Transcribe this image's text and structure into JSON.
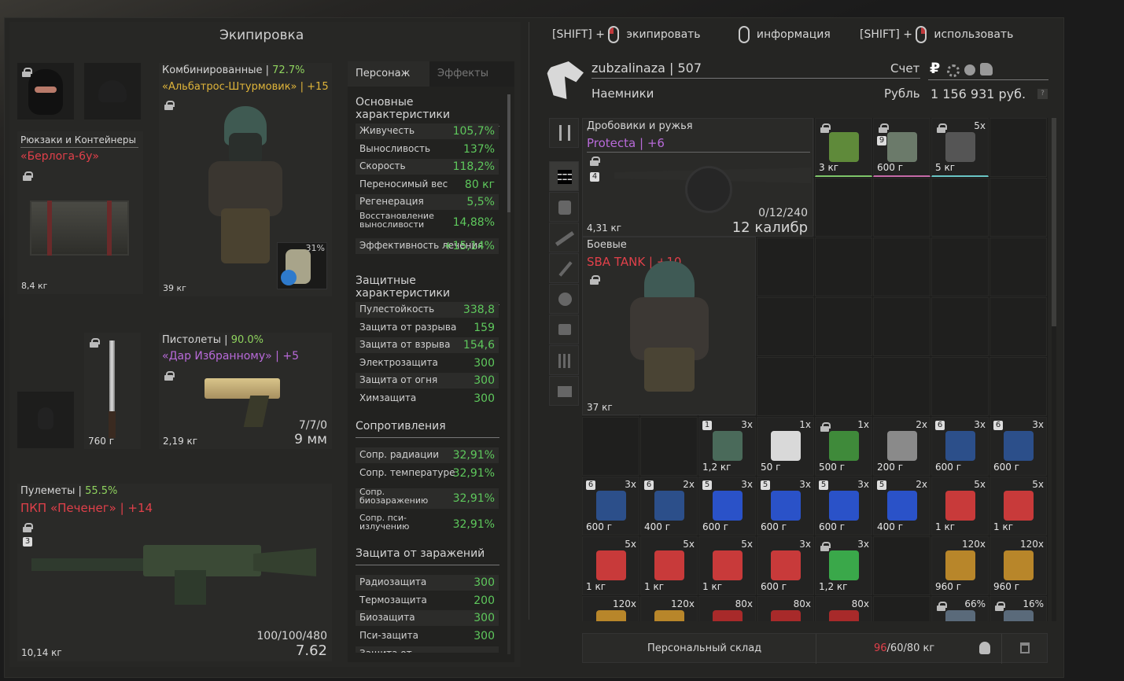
{
  "window_title": "Экипировка",
  "hints": [
    {
      "prefix": "[SHIFT] +",
      "label": "экипировать",
      "mouse": "left"
    },
    {
      "prefix": "",
      "label": "информация",
      "mouse": "none"
    },
    {
      "prefix": "[SHIFT] +",
      "label": "использовать",
      "mouse": "right"
    }
  ],
  "equipment": {
    "armor": {
      "category": "Комбинированные",
      "pct": "72.7%",
      "name": "«Альбатрос-Штурмовик» | +15",
      "weight": "39 кг",
      "plate_pct": "31%"
    },
    "backpack": {
      "category": "Рюкзаки и Контейнеры",
      "name": "«Берлога-6у»",
      "weight": "8,4 кг"
    },
    "knife": {
      "weight": "760 г"
    },
    "pistol": {
      "category": "Пистолеты",
      "pct": "90.0%",
      "name_a": "«Дар Избранному»",
      "name_b": " | +5",
      "weight": "2,19 кг",
      "ammo": "7/7/0",
      "caliber": "9 мм"
    },
    "mg": {
      "category": "Пулеметы",
      "pct": "55.5%",
      "name": "ПКП «Печенег» | +14",
      "badge": "3",
      "weight": "10,14 кг",
      "ammo": "100/100/480",
      "caliber": "7.62"
    }
  },
  "stats_tabs": [
    {
      "label": "Персонаж"
    },
    {
      "label": "Эффекты"
    }
  ],
  "stat_sections": [
    {
      "title": "Основные характеристики",
      "rows": [
        {
          "name": "Живучесть",
          "value": "105,7%"
        },
        {
          "name": "Выносливость",
          "value": "137%"
        },
        {
          "name": "Скорость",
          "value": "118,2%"
        },
        {
          "name": "Переносимый вес",
          "value": "80 кг"
        },
        {
          "name": "Регенерация",
          "value": "5,5%"
        },
        {
          "name": "Восстановление выносливости",
          "value": "14,88%"
        },
        {
          "name": "Эффективность лечения",
          "value": "+15,14%"
        }
      ]
    },
    {
      "title": "Защитные характеристики",
      "rows": [
        {
          "name": "Пулестойкость",
          "value": "338,8"
        },
        {
          "name": "Защита от разрыва",
          "value": "159"
        },
        {
          "name": "Защита от взрыва",
          "value": "154,6"
        },
        {
          "name": "Электрозащита",
          "value": "300"
        },
        {
          "name": "Защита от огня",
          "value": "300"
        },
        {
          "name": "Химзащита",
          "value": "300"
        }
      ]
    },
    {
      "title": "Сопротивления",
      "rows": [
        {
          "name": "Сопр. радиации",
          "value": "32,91%"
        },
        {
          "name": "Сопр. температуре",
          "value": "32,91%"
        },
        {
          "name": "Сопр. биозаражению",
          "value": "32,91%"
        },
        {
          "name": "Сопр. пси-излучению",
          "value": "32,91%"
        }
      ]
    },
    {
      "title": "Защита от заражений",
      "rows": [
        {
          "name": "Радиозащита",
          "value": "300"
        },
        {
          "name": "Термозащита",
          "value": "200"
        },
        {
          "name": "Биозащита",
          "value": "300"
        },
        {
          "name": "Пси-защита",
          "value": "300"
        },
        {
          "name": "Защита от",
          "value": ""
        }
      ]
    }
  ],
  "player": {
    "name": "zubzalinaza",
    "level": "507",
    "faction": "Наемники",
    "account_label": "Счет",
    "currency": "Рубль",
    "balance": "1 156 931 руб.",
    "currency_symbol": "₽"
  },
  "stash_items": {
    "shotgun": {
      "category": "Дробовики и ружья",
      "name": "Protecta | +6",
      "badge": "4",
      "weight": "4,31 кг",
      "ammo": "0/12/240",
      "caliber": "12 калибр"
    },
    "armor2": {
      "category": "Боевые",
      "name": "SBA TANK | +10",
      "weight": "37 кг"
    }
  },
  "grid": [
    {
      "row": 0,
      "col": 4,
      "weight": "3 кг",
      "count": "",
      "color": "#5f8a3a",
      "under": "#7ec56a",
      "lock": true
    },
    {
      "row": 0,
      "col": 5,
      "weight": "600 г",
      "count": "",
      "color": "#6b7a6a",
      "under": "#c56aa8",
      "lock": true,
      "badge": "9"
    },
    {
      "row": 0,
      "col": 6,
      "weight": "5 кг",
      "count": "5x",
      "color": "#555",
      "under": "#6ac5c5",
      "lock": true
    },
    {
      "row": 5,
      "col": 2,
      "weight": "1,2 кг",
      "count": "3x",
      "color": "#4a6a5a",
      "badge": "1"
    },
    {
      "row": 5,
      "col": 3,
      "weight": "50 г",
      "count": "1x",
      "color": "#d9d9d9"
    },
    {
      "row": 5,
      "col": 4,
      "weight": "500 г",
      "count": "1x",
      "color": "#3f8a3a",
      "lock": true
    },
    {
      "row": 5,
      "col": 5,
      "weight": "200 г",
      "count": "2x",
      "color": "#8a8a8a"
    },
    {
      "row": 5,
      "col": 6,
      "weight": "600 г",
      "count": "3x",
      "color": "#2c4f8a",
      "badge": "6"
    },
    {
      "row": 5,
      "col": 7,
      "weight": "600 г",
      "count": "3x",
      "color": "#2c4f8a",
      "badge": "6"
    },
    {
      "row": 6,
      "col": 0,
      "weight": "600 г",
      "count": "3x",
      "color": "#2c4f8a",
      "badge": "6"
    },
    {
      "row": 6,
      "col": 1,
      "weight": "400 г",
      "count": "2x",
      "color": "#2c4f8a",
      "badge": "6"
    },
    {
      "row": 6,
      "col": 2,
      "weight": "600 г",
      "count": "3x",
      "color": "#2a52c8",
      "badge": "5"
    },
    {
      "row": 6,
      "col": 3,
      "weight": "600 г",
      "count": "3x",
      "color": "#2a52c8",
      "badge": "5"
    },
    {
      "row": 6,
      "col": 4,
      "weight": "600 г",
      "count": "3x",
      "color": "#2a52c8",
      "badge": "5"
    },
    {
      "row": 6,
      "col": 5,
      "weight": "400 г",
      "count": "2x",
      "color": "#2a52c8",
      "badge": "5"
    },
    {
      "row": 6,
      "col": 6,
      "weight": "1 кг",
      "count": "5x",
      "color": "#c83a3a"
    },
    {
      "row": 6,
      "col": 7,
      "weight": "1 кг",
      "count": "5x",
      "color": "#c83a3a"
    },
    {
      "row": 7,
      "col": 0,
      "weight": "1 кг",
      "count": "5x",
      "color": "#c83a3a"
    },
    {
      "row": 7,
      "col": 1,
      "weight": "1 кг",
      "count": "5x",
      "color": "#c83a3a"
    },
    {
      "row": 7,
      "col": 2,
      "weight": "1 кг",
      "count": "5x",
      "color": "#c83a3a"
    },
    {
      "row": 7,
      "col": 3,
      "weight": "600 г",
      "count": "3x",
      "color": "#c83a3a"
    },
    {
      "row": 7,
      "col": 4,
      "weight": "1,2 кг",
      "count": "3x",
      "color": "#3aa84a",
      "lock": true
    },
    {
      "row": 7,
      "col": 6,
      "weight": "960 г",
      "count": "120x",
      "color": "#b8862a"
    },
    {
      "row": 7,
      "col": 7,
      "weight": "960 г",
      "count": "120x",
      "color": "#b8862a"
    },
    {
      "row": 8,
      "col": 0,
      "weight": "",
      "count": "120x",
      "color": "#b8862a"
    },
    {
      "row": 8,
      "col": 1,
      "weight": "",
      "count": "120x",
      "color": "#b8862a"
    },
    {
      "row": 8,
      "col": 2,
      "weight": "",
      "count": "80x",
      "color": "#a82a2a"
    },
    {
      "row": 8,
      "col": 3,
      "weight": "",
      "count": "80x",
      "color": "#a82a2a"
    },
    {
      "row": 8,
      "col": 4,
      "weight": "",
      "count": "80x",
      "color": "#a82a2a"
    },
    {
      "row": 8,
      "col": 6,
      "weight": "",
      "count": "66%",
      "color": "#5a6a7a",
      "lock": true
    },
    {
      "row": 8,
      "col": 7,
      "weight": "",
      "count": "16%",
      "color": "#5a6a7a",
      "lock": true
    }
  ],
  "footer": {
    "stash_label": "Персональный склад",
    "weight_current": "96",
    "weight_rest": "/60/80 кг"
  }
}
